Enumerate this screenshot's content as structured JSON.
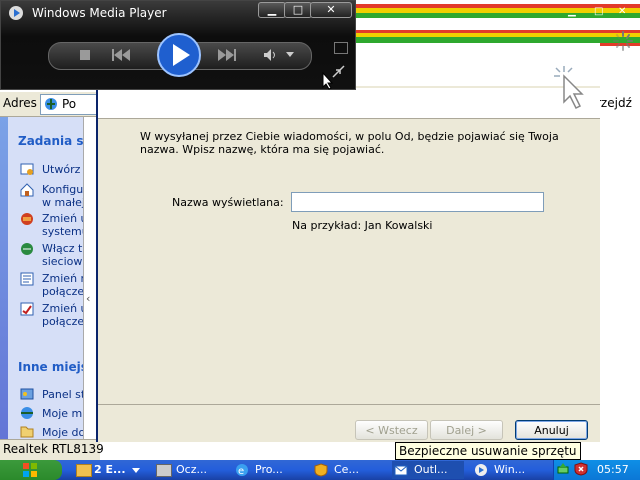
{
  "wmp": {
    "title": "Windows Media Player",
    "buttons": {
      "minimize": "▁",
      "maximize": "□",
      "close": "✕"
    }
  },
  "explorer": {
    "address_label": "Adres",
    "address_text": "Po",
    "task_header": "Zadania sie",
    "tasks": [
      {
        "text": "Utwórz n",
        "icon": "new-connection-icon"
      },
      {
        "text": "Konfigur\nw małej",
        "icon": "home-network-icon"
      },
      {
        "text": "Zmień u\nsystemu",
        "icon": "firewall-icon"
      },
      {
        "text": "Włącz to\nsieciowe",
        "icon": "network-icon"
      },
      {
        "text": "Zmień n\npołączen",
        "icon": "connection-icon"
      },
      {
        "text": "Zmień u\npołączen",
        "icon": "settings-icon"
      }
    ],
    "other_header": "Inne miejsc",
    "other": [
      {
        "text": "Panel stero",
        "icon": "control-panel-icon"
      },
      {
        "text": "Moje miejsc",
        "icon": "network-places-icon"
      },
      {
        "text": "Moje dokum",
        "icon": "documents-icon"
      }
    ],
    "status": "Realtek RTL8139"
  },
  "right_window": {
    "partial_label": "rzejdź"
  },
  "dialog": {
    "intro": "W wysyłanej przez Ciebie wiadomości, w polu Od, będzie pojawiać się Twoja nazwa. Wpisz nazwę, która ma się pojawiać.",
    "display_name_label": "Nazwa wyświetlana:",
    "display_name_value": "",
    "example": "Na przykład: Jan Kowalski",
    "back_button": "< Wstecz",
    "next_button": "Dalej >",
    "cancel_button": "Anuluj"
  },
  "tooltip": "Bezpieczne usuwanie sprzętu",
  "taskbar": {
    "items": [
      {
        "label": "2 E...",
        "icon": "folder-icon"
      },
      {
        "label": "Ocz...",
        "icon": "printer-icon"
      },
      {
        "label": "Pro...",
        "icon": "ie-icon"
      },
      {
        "label": "Ce...",
        "icon": "security-center-icon"
      },
      {
        "label": "Outl...",
        "icon": "outlook-icon"
      },
      {
        "label": "Win...",
        "icon": "wmp-icon"
      }
    ],
    "clock": "05:57"
  },
  "colors": {
    "accent": "#245edb",
    "start": "#2b8a2b",
    "dialog_bg": "#ece9d8"
  }
}
